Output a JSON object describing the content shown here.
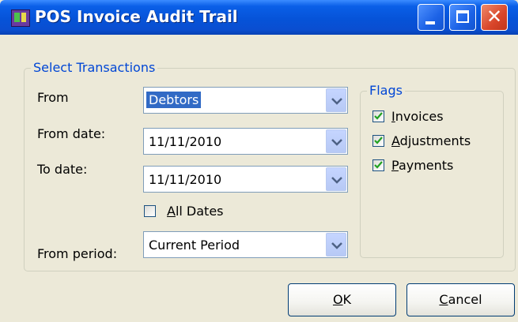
{
  "window": {
    "title": "POS Invoice Audit Trail",
    "controls": {
      "minimize_icon": "minimize-icon",
      "maximize_icon": "maximize-icon",
      "close_icon": "close-icon"
    }
  },
  "select_transactions": {
    "legend": "Select Transactions",
    "from_label": "From",
    "from_value": "Debtors",
    "from_date_label": "From date:",
    "from_date_value": "11/11/2010",
    "to_date_label": "To date:",
    "to_date_value": "11/11/2010",
    "all_dates": {
      "accel": "A",
      "rest": "ll Dates",
      "checked": false
    },
    "from_period_label": "From period:",
    "from_period_value": "Current Period"
  },
  "flags": {
    "legend": "Flags",
    "items": [
      {
        "accel": "I",
        "rest": "nvoices",
        "checked": true
      },
      {
        "accel": "A",
        "rest": "djustments",
        "checked": true
      },
      {
        "accel": "P",
        "rest": "ayments",
        "checked": true
      }
    ]
  },
  "buttons": {
    "ok": {
      "accel": "O",
      "rest": "K"
    },
    "cancel": {
      "accel": "C",
      "rest": "ancel"
    }
  },
  "colors": {
    "titlebar": "#0653d8",
    "legend_text": "#0046d5",
    "selection": "#316ac5",
    "check": "#21a121"
  }
}
